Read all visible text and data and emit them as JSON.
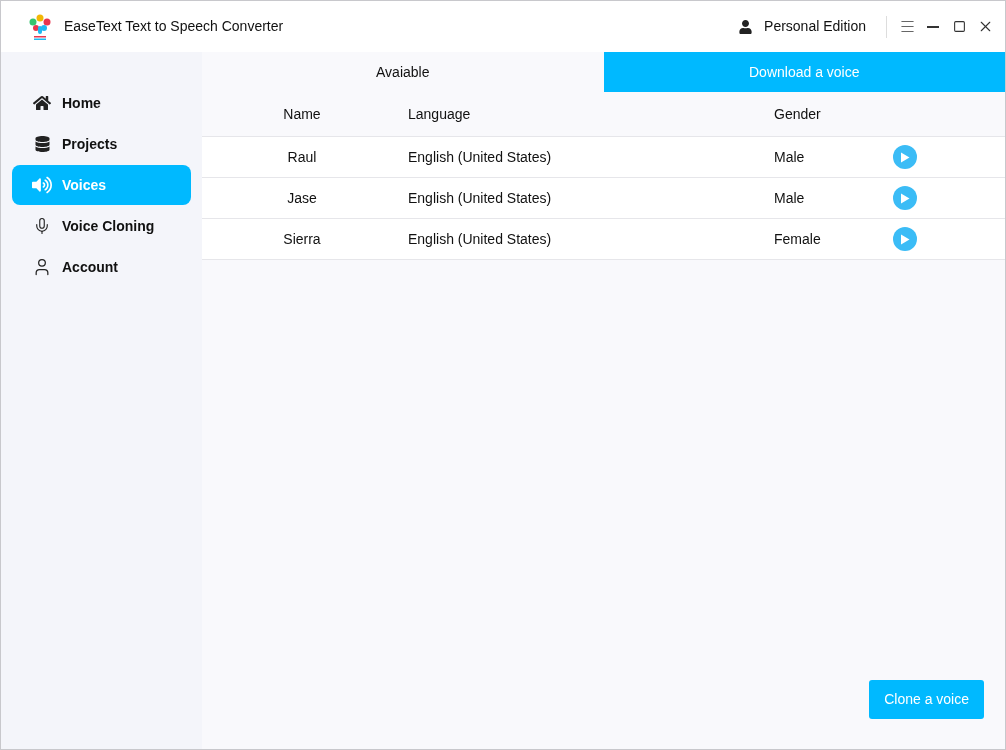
{
  "window": {
    "title": "EaseText Text to Speech Converter",
    "edition": "Personal Edition"
  },
  "sidebar": {
    "items": [
      {
        "label": "Home",
        "selected": false
      },
      {
        "label": "Projects",
        "selected": false
      },
      {
        "label": "Voices",
        "selected": true
      },
      {
        "label": "Voice Cloning",
        "selected": false
      },
      {
        "label": "Account",
        "selected": false
      }
    ]
  },
  "tabs": [
    {
      "label": "Avaiable",
      "selected": true
    },
    {
      "label": "Download a voice",
      "selected": false
    }
  ],
  "table": {
    "columns": [
      "Name",
      "Language",
      "Gender"
    ],
    "rows": [
      {
        "name": "Raul",
        "language": "English (United States)",
        "gender": "Male"
      },
      {
        "name": "Jase",
        "language": "English (United States)",
        "gender": "Male"
      },
      {
        "name": "Sierra",
        "language": "English (United States)",
        "gender": "Female"
      }
    ]
  },
  "clone_button": "Clone a voice"
}
